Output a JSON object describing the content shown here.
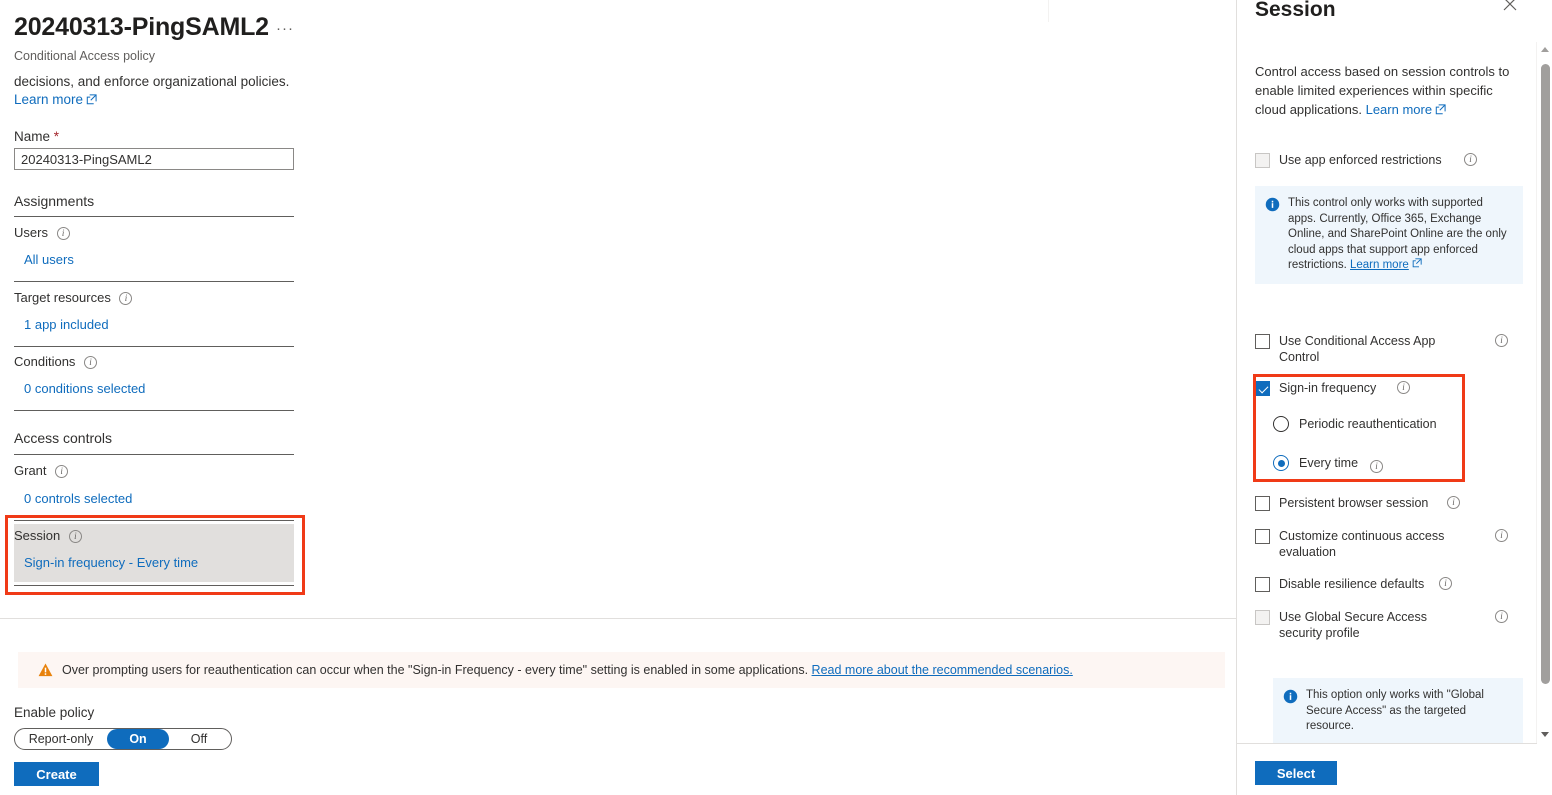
{
  "left_pane": {
    "policy_title": "20240313-PingSAML2",
    "ellipsis_label": "···",
    "subtitle": "Conditional Access policy",
    "description_text": "decisions, and enforce organizational policies.",
    "learn_more": "Learn more",
    "name_field": {
      "label": "Name",
      "required_mark": "*",
      "value": "20240313-PingSAML2"
    },
    "assignments": {
      "heading": "Assignments",
      "rows": [
        {
          "label": "Users",
          "value": "All users"
        },
        {
          "label": "Target resources",
          "value": "1 app included"
        },
        {
          "label": "Conditions",
          "value": "0 conditions selected"
        }
      ]
    },
    "access_controls": {
      "heading": "Access controls",
      "rows": [
        {
          "label": "Grant",
          "value": "0 controls selected"
        },
        {
          "label": "Session",
          "value": "Sign-in frequency - Every time"
        }
      ]
    },
    "warning": {
      "text": "Over prompting users for reauthentication can occur when the \"Sign-in Frequency - every time\" setting is enabled in some applications.",
      "link": "Read more about the recommended scenarios."
    },
    "enable_policy": {
      "label": "Enable policy",
      "options": [
        "Report-only",
        "On",
        "Off"
      ],
      "selected": "On"
    },
    "create_button": "Create"
  },
  "session_panel": {
    "title": "Session",
    "close_label": "✕",
    "description": "Control access based on session controls to enable limited experiences within specific cloud applications.",
    "learn_more": "Learn more",
    "controls": [
      {
        "label": "Use app enforced restrictions",
        "checked": false,
        "disabled": true
      },
      {
        "label": "Use Conditional Access App Control",
        "checked": false,
        "disabled": false
      },
      {
        "label": "Sign-in frequency",
        "checked": true,
        "disabled": false
      },
      {
        "label": "Persistent browser session",
        "checked": false,
        "disabled": false
      },
      {
        "label": "Customize continuous access evaluation",
        "checked": false,
        "disabled": false
      },
      {
        "label": "Disable resilience defaults",
        "checked": false,
        "disabled": false
      },
      {
        "label": "Use Global Secure Access security profile",
        "checked": false,
        "disabled": true
      }
    ],
    "info_app_enforced": {
      "text": "This control only works with supported apps. Currently, Office 365, Exchange Online, and SharePoint Online are the only cloud apps that support app enforced restrictions.",
      "link": "Learn more"
    },
    "sign_in_frequency_options": [
      {
        "label": "Periodic reauthentication",
        "selected": false
      },
      {
        "label": "Every time",
        "selected": true
      }
    ],
    "info_global_secure_access": {
      "text": "This option only works with \"Global Secure Access\" as the targeted resource."
    },
    "select_button": "Select"
  },
  "colors": {
    "accent_blue": "#0f6cbd",
    "link_blue": "#0f6cbd",
    "highlight_red": "#f03a17",
    "warning_orange": "#e8820c",
    "selected_row_gray": "#e1dfdd",
    "info_box_blue": "#eff6fc",
    "warning_bg": "#fdf6f3"
  }
}
